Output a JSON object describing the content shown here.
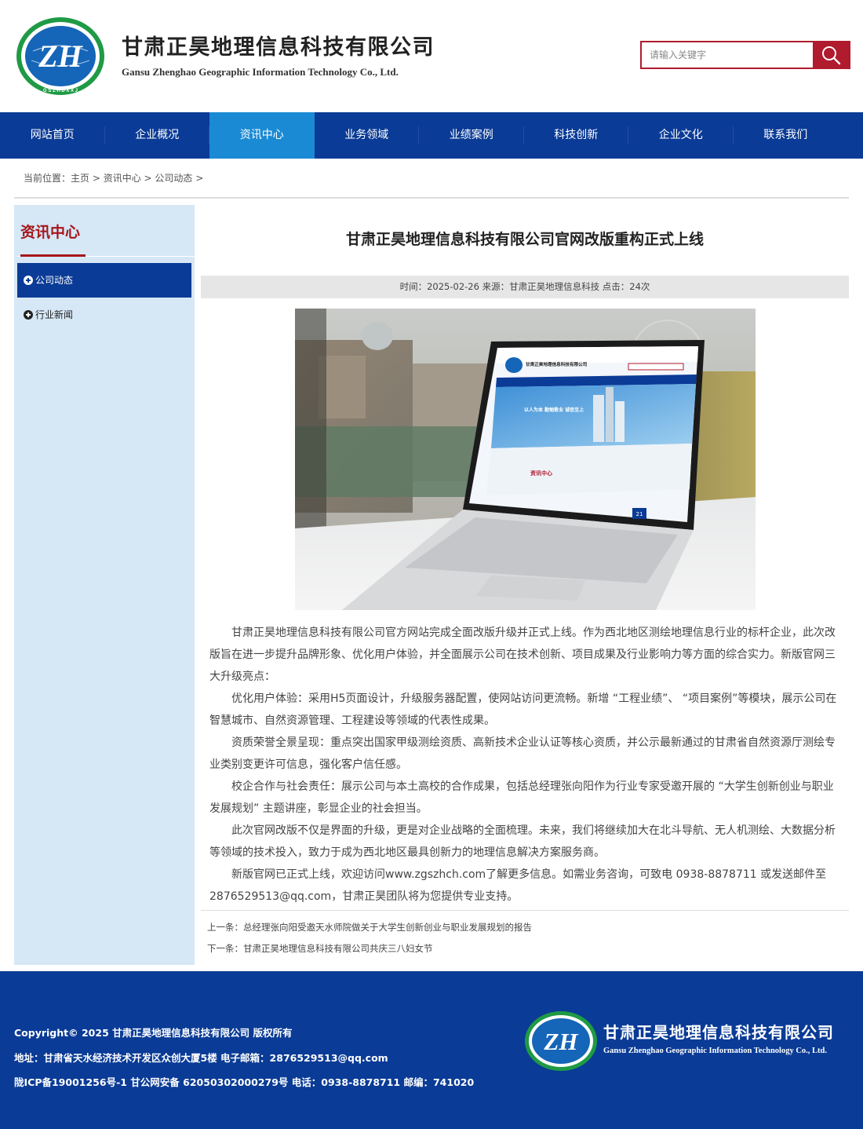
{
  "header": {
    "company_name": "甘肃正昊地理信息科技有限公司",
    "company_en": "Gansu Zhenghao Geographic Information Technology Co., Ltd.",
    "logo_letters": "ZH",
    "logo_ring_text": "G S Z H D X X J",
    "search_placeholder": "请输入关键字"
  },
  "nav": [
    {
      "label": "网站首页"
    },
    {
      "label": "企业概况"
    },
    {
      "label": "资讯中心",
      "active": true
    },
    {
      "label": "业务领域"
    },
    {
      "label": "业绩案例"
    },
    {
      "label": "科技创新"
    },
    {
      "label": "企业文化"
    },
    {
      "label": "联系我们"
    }
  ],
  "breadcrumb": {
    "prefix": "当前位置：",
    "items": [
      "主页",
      "资讯中心",
      "公司动态"
    ],
    "separator": " > "
  },
  "sidebar": {
    "title": "资讯中心",
    "items": [
      {
        "label": "公司动态",
        "active": true
      },
      {
        "label": "行业新闻"
      }
    ]
  },
  "article": {
    "title": "甘肃正昊地理信息科技有限公司官网改版重构正式上线",
    "meta": "时间：2025-02-26  来源：甘肃正昊地理信息科技  点击：24次",
    "image_screen": {
      "header_name": "甘肃正昊地理信息科技有限公司",
      "banner_text": "以人为本 勤勉敬业 诚信至上",
      "section_title": "资讯中心",
      "page_number": "21"
    },
    "paragraphs": [
      "甘肃正昊地理信息科技有限公司官方网站完成全面改版升级并正式上线。作为西北地区测绘地理信息行业的标杆企业，此次改版旨在进一步提升品牌形象、优化用户体验，并全面展示公司在技术创新、项目成果及行业影响力等方面的综合实力。新版官网三大升级亮点：",
      "优化用户体验：采用H5页面设计，升级服务器配置，使网站访问更流畅。新增 “工程业绩”、 “项目案例”等模块，展示公司在智慧城市、自然资源管理、工程建设等领域的代表性成果。",
      "资质荣誉全景呈现：重点突出国家甲级测绘资质、高新技术企业认证等核心资质，并公示最新通过的甘肃省自然资源厅测绘专业类别变更许可信息，强化客户信任感。",
      "校企合作与社会责任：展示公司与本土高校的合作成果，包括总经理张向阳作为行业专家受邀开展的 “大学生创新创业与职业发展规划” 主题讲座，彰显企业的社会担当。",
      "此次官网改版不仅是界面的升级，更是对企业战略的全面梳理。未来，我们将继续加大在北斗导航、无人机测绘、大数据分析等领域的技术投入，致力于成为西北地区最具创新力的地理信息解决方案服务商。",
      "新版官网已正式上线，欢迎访问www.zgszhch.com了解更多信息。如需业务咨询，可致电 0938-8878711 或发送邮件至2876529513@qq.com，甘肃正昊团队将为您提供专业支持。"
    ],
    "prev": "上一条：总经理张向阳受邀天水师院做关于大学生创新创业与职业发展规划的报告",
    "next": "下一条：甘肃正昊地理信息科技有限公司共庆三八妇女节"
  },
  "footer": {
    "copyright": "Copyright© 2025   甘肃正昊地理信息科技有限公司 版权所有",
    "address": "地址：甘肃省天水经济技术开发区众创大厦5楼   电子邮箱：2876529513@qq.com",
    "icp": "陇ICP备19001256号-1   甘公网安备 62050302000279号   电话：0938-8878711    邮编：741020",
    "company_name": "甘肃正昊地理信息科技有限公司",
    "company_en": "Gansu Zhenghao Geographic Information Technology Co., Ltd."
  },
  "colors": {
    "brand_blue": "#0a3b96",
    "nav_active": "#1a8ad4",
    "accent_red": "#b01b2e",
    "sidebar_bg": "#d6e7f6"
  }
}
